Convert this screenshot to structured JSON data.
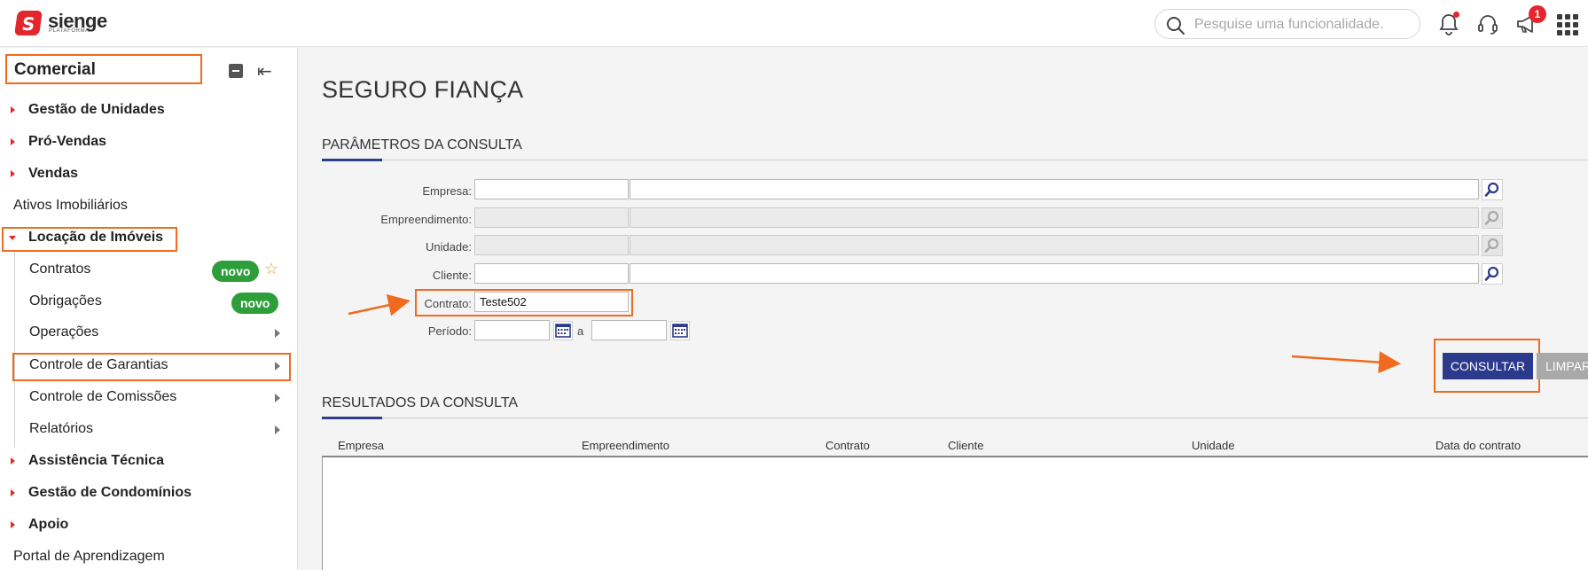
{
  "brand": {
    "name": "sienge",
    "sub": "PLATAFORMA",
    "mark": "S"
  },
  "search": {
    "placeholder": "Pesquise uma funcionalidade."
  },
  "notifications": {
    "badge_count": "1"
  },
  "sidebar": {
    "module": "Comercial",
    "items": [
      {
        "label": "Gestão de Unidades"
      },
      {
        "label": "Pró-Vendas"
      },
      {
        "label": "Vendas"
      },
      {
        "label": "Ativos Imobiliários"
      },
      {
        "label": "Locação de Imóveis"
      },
      {
        "label": "Contratos",
        "badge": "novo"
      },
      {
        "label": "Obrigações",
        "badge": "novo"
      },
      {
        "label": "Operações"
      },
      {
        "label": "Controle de Garantias"
      },
      {
        "label": "Controle de Comissões"
      },
      {
        "label": "Relatórios"
      },
      {
        "label": "Assistência Técnica"
      },
      {
        "label": "Gestão de Condomínios"
      },
      {
        "label": "Apoio"
      },
      {
        "label": "Portal de Aprendizagem"
      }
    ]
  },
  "page": {
    "title": "SEGURO FIANÇA",
    "params_title": "PARÂMETROS DA CONSULTA",
    "results_title": "RESULTADOS DA CONSULTA"
  },
  "form": {
    "empresa_label": "Empresa:",
    "empreendimento_label": "Empreendimento:",
    "unidade_label": "Unidade:",
    "cliente_label": "Cliente:",
    "contrato_label": "Contrato:",
    "contrato_value": "Teste502",
    "periodo_label": "Período:",
    "periodo_sep": "a"
  },
  "buttons": {
    "consultar": "CONSULTAR",
    "limpar": "LIMPAR"
  },
  "table": {
    "columns": [
      "Empresa",
      "Empreendimento",
      "Contrato",
      "Cliente",
      "Unidade",
      "Data do contrato"
    ]
  },
  "colors": {
    "accent": "#2c3a8c",
    "brand": "#e3262d",
    "highlight": "#f06b1f",
    "badge": "#2e9e3b"
  }
}
